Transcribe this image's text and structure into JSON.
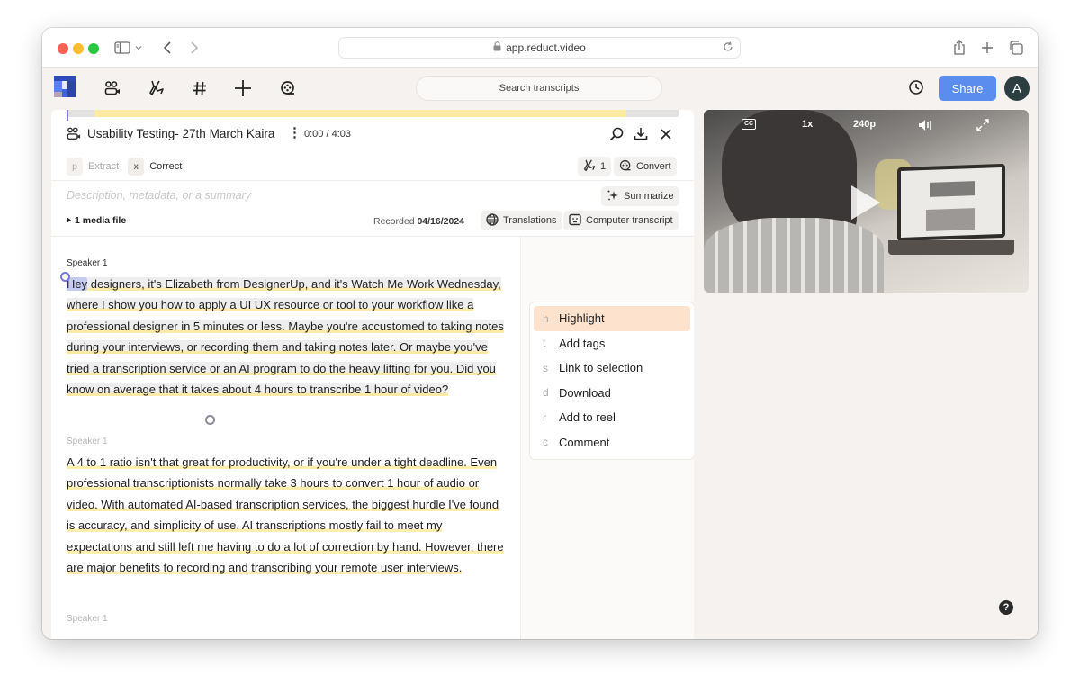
{
  "browser": {
    "url": "app.reduct.video"
  },
  "appbar": {
    "nav_icons": [
      "people-video-icon",
      "highlighter-icon",
      "hashtag-icon",
      "plus-icon",
      "reel-icon"
    ],
    "search_placeholder": "Search transcripts",
    "share_label": "Share",
    "avatar_initial": "A"
  },
  "document": {
    "title": "Usability Testing- 27th March Kaira",
    "time": "0:00 / 4:03",
    "timeline": {
      "highlighted_start_fraction": 0.045,
      "highlighted_end_fraction": 0.915
    },
    "modes": [
      {
        "key": "p",
        "label": "Extract",
        "active": false
      },
      {
        "key": "x",
        "label": "Correct",
        "active": true
      }
    ],
    "highlight_count": "1",
    "convert_label": "Convert",
    "description_placeholder": "Description, metadata, or a summary",
    "summarize_label": "Summarize",
    "media_files_label": "1 media file",
    "recorded_label": "Recorded",
    "recorded_date": "04/16/2024",
    "translations_label": "Translations",
    "computer_transcript_label": "Computer transcript"
  },
  "transcript": {
    "paragraphs": [
      {
        "speaker": "Speaker 1",
        "first_word": "Hey",
        "selected_text": " designers, it's Elizabeth from DesignerUp, and it's Watch Me Work Wednesday, where I show you how to apply a UI UX resource or tool to your workflow like a professional designer in 5 minutes or less. ",
        "highlighted_text": "Maybe you're accustomed to taking notes during your interviews, or recording them and taking notes later. Or maybe you've tried a transcription service or an AI program to do the heavy lifting for you. Did you know on average that it takes about 4 hours to transcribe 1 hour of video?"
      },
      {
        "speaker": "Speaker 1",
        "highlighted_text": "A 4 to 1 ratio isn't that great for productivity, or if you're under a tight deadline. Even professional transcriptionists normally take 3 hours to convert 1 hour of audio or video. With automated AI-based transcription services, the biggest hurdle I've found is accuracy, and simplicity of use. AI transcriptions mostly fail to meet my expectations and still left me having to do a lot of correction by hand. However, there are major benefits to recording and transcribing your remote user interviews."
      },
      {
        "speaker": "Speaker 1"
      }
    ]
  },
  "context_menu": {
    "items": [
      {
        "key": "h",
        "label": "Highlight",
        "active": true
      },
      {
        "key": "t",
        "label": "Add tags",
        "active": false
      },
      {
        "key": "s",
        "label": "Link to selection",
        "active": false
      },
      {
        "key": "d",
        "label": "Download",
        "active": false
      },
      {
        "key": "r",
        "label": "Add to reel",
        "active": false
      },
      {
        "key": "c",
        "label": "Comment",
        "active": false
      }
    ]
  },
  "video": {
    "captions_label": "CC",
    "speed": "1x",
    "quality": "240p"
  },
  "colors": {
    "accent": "#5a8dee",
    "highlight_yellow": "#fdeeb0",
    "menu_active": "#fde3cd",
    "selection": "#c5cbf0"
  }
}
